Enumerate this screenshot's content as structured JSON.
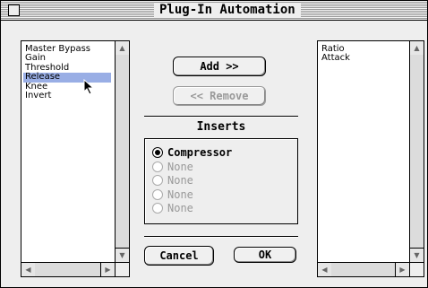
{
  "window": {
    "title": "Plug-In Automation"
  },
  "left_list": {
    "items": [
      "Master Bypass",
      "Gain",
      "Threshold",
      "Release",
      "Knee",
      "Invert"
    ],
    "selected_index": 3
  },
  "right_list": {
    "items": [
      "Ratio",
      "Attack"
    ]
  },
  "buttons": {
    "add_label": "Add >>",
    "remove_label": "<< Remove",
    "cancel_label": "Cancel",
    "ok_label": "OK"
  },
  "inserts": {
    "title": "Inserts",
    "options": [
      {
        "label": "Compressor",
        "selected": true,
        "enabled": true
      },
      {
        "label": "None",
        "selected": false,
        "enabled": false
      },
      {
        "label": "None",
        "selected": false,
        "enabled": false
      },
      {
        "label": "None",
        "selected": false,
        "enabled": false
      },
      {
        "label": "None",
        "selected": false,
        "enabled": false
      }
    ]
  },
  "icons": {
    "close_box": "close-box-icon",
    "scroll_up": "arrow-up-icon",
    "scroll_down": "arrow-down-icon",
    "scroll_left": "arrow-left-icon",
    "scroll_right": "arrow-right-icon",
    "cursor": "mouse-pointer-icon"
  }
}
